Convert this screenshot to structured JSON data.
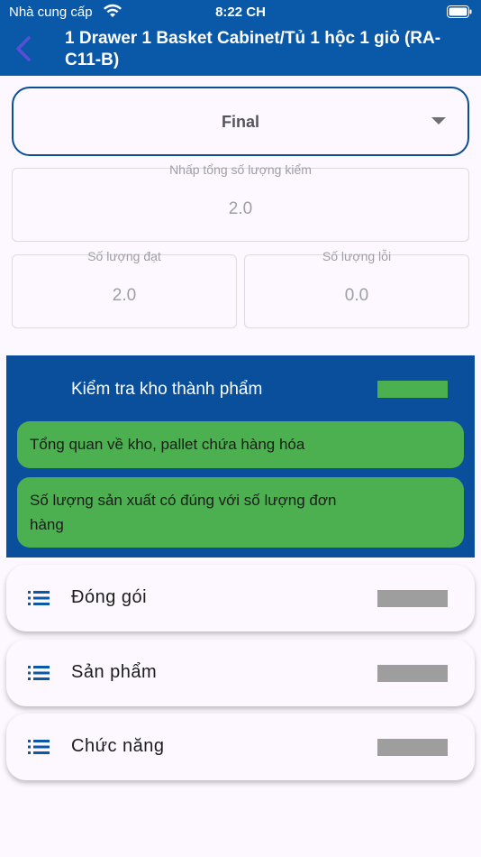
{
  "status_bar": {
    "carrier": "Nhà cung cấp",
    "time": "8:22 CH",
    "wifi_icon": "wifi-icon",
    "battery_icon": "battery-icon"
  },
  "header": {
    "back_icon": "chevron-left-icon",
    "title": "1 Drawer 1 Basket Cabinet/Tủ 1 hộc 1 giỏ (RA-C11-B)"
  },
  "stage_select": {
    "value": "Final",
    "arrow_icon": "triangle-down-icon"
  },
  "fields": {
    "total": {
      "label": "Nhấp tổng số lượng kiểm",
      "value": "2.0"
    },
    "pass": {
      "label": "Số lượng đạt",
      "value": "2.0"
    },
    "fail": {
      "label": "Số lượng lỗi",
      "value": "0.0"
    }
  },
  "section_expanded": {
    "title": "Kiểm tra kho thành phẩm",
    "status_color": "#4caf50",
    "items": [
      {
        "label": "Tổng quan về kho, pallet chứa hàng hóa"
      },
      {
        "label": "Số lượng sản xuất có đúng với số lượng đơn hàng"
      }
    ]
  },
  "sections_collapsed": [
    {
      "label": "Đóng gói",
      "icon": "list-icon"
    },
    {
      "label": "Sản phẩm",
      "icon": "list-icon"
    },
    {
      "label": "Chức năng",
      "icon": "list-icon"
    }
  ],
  "colors": {
    "header_bg": "#0a58a8",
    "section_bg": "#0a4f9c",
    "item_green": "#4caf50",
    "pending_gray": "#9e9e9e"
  }
}
